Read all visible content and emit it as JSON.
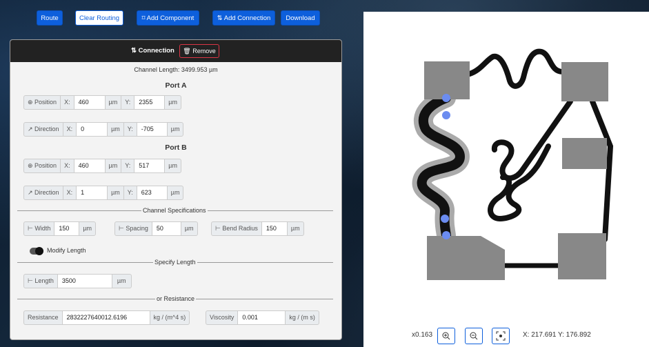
{
  "toolbar": {
    "route": "Route",
    "clear_routing": "Clear Routing",
    "add_component": "Add Component",
    "add_connection": "Add Connection",
    "download": "Download"
  },
  "panel": {
    "title": "Connection",
    "remove": "Remove",
    "channel_length": "Channel Length: 3499.953 µm",
    "port_a": {
      "title": "Port A",
      "position_label": "Position",
      "pos_x": "460",
      "pos_y": "2355",
      "direction_label": "Direction",
      "dir_x": "0",
      "dir_y": "-705"
    },
    "port_b": {
      "title": "Port B",
      "position_label": "Position",
      "pos_x": "460",
      "pos_y": "517",
      "direction_label": "Direction",
      "dir_x": "1",
      "dir_y": "623"
    },
    "x_label": "X:",
    "y_label": "Y:",
    "unit_um": "µm",
    "channel_specs": {
      "title": "Channel Specifications",
      "width_label": "Width",
      "width": "150",
      "spacing_label": "Spacing",
      "spacing": "50",
      "bend_label": "Bend Radius",
      "bend": "150"
    },
    "modify_length": {
      "label": "Modify Length",
      "on": true
    },
    "specify_length": {
      "title": "Specify Length",
      "length_label": "Length",
      "length": "3500"
    },
    "resistance": {
      "title": "or Resistance",
      "resistance_label": "Resistance",
      "resistance": "2832227640012.6196",
      "resistance_unit": "kg / (m^4 s)",
      "viscosity_label": "Viscosity",
      "viscosity": "0.001",
      "viscosity_unit": "kg / (m s)"
    }
  },
  "statusbar": {
    "zoom": "x0.163",
    "coords": "X: 217.691 Y: 176.892"
  },
  "icons": [
    "add-component-icon",
    "add-connection-icon",
    "connection-icon",
    "trash-icon",
    "crosshair-icon",
    "arrow-icon",
    "width-icon",
    "zoom-in-icon",
    "zoom-out-icon",
    "fit-icon"
  ],
  "colors": {
    "primary": "#0d5fdc",
    "component": "#888888",
    "channel": "#111111",
    "highlight": "#aaaaaa",
    "port": "#6b8cf0"
  }
}
